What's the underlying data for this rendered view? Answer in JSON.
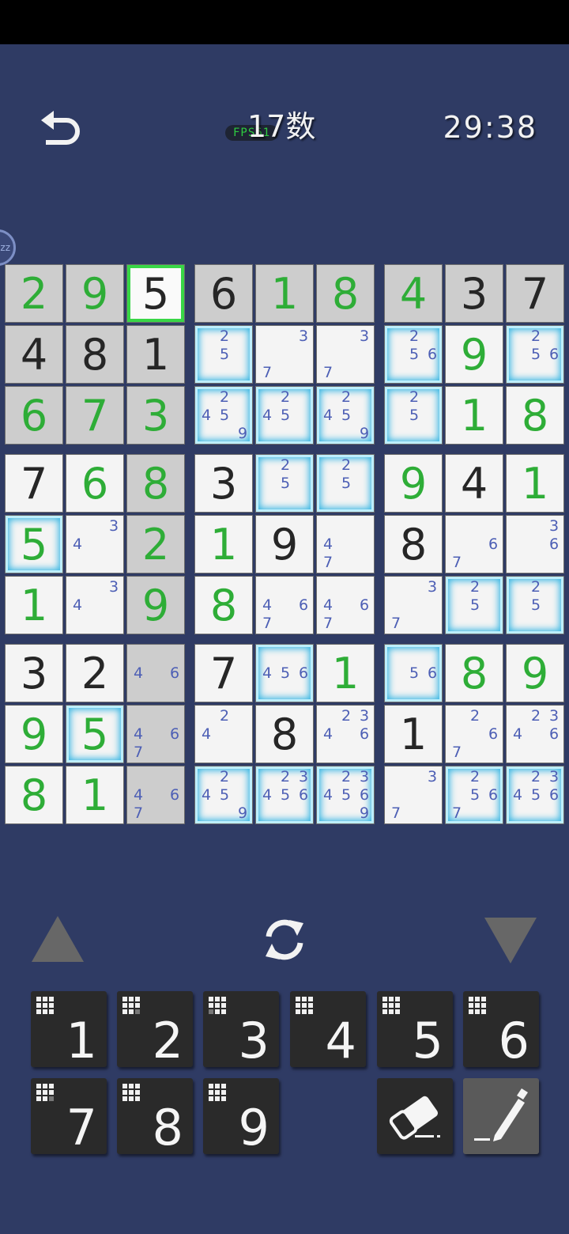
{
  "header": {
    "title": "17数",
    "fps": "FPS61",
    "timer": "29:38",
    "float_label": "zz"
  },
  "colors": {
    "background": "#2f3b64",
    "given_cell": "#cdcdcd",
    "empty_cell": "#f4f4f4",
    "user_digit": "#2ead37",
    "given_digit": "#262626",
    "note_digit": "#4d5fb5",
    "selection": "#38d646",
    "highlight_glow": "#37b6e3"
  },
  "board": {
    "cells": [
      [
        "g2",
        "g9",
        "k5",
        "k6",
        "g1",
        "g8",
        "g4",
        "k3",
        "k7"
      ],
      [
        "k4",
        "k8",
        "k1",
        "25",
        "37",
        "37",
        "256",
        "g9",
        "256"
      ],
      [
        "g6",
        "g7",
        "g3",
        "2459",
        "245",
        "2459",
        "25",
        "g1",
        "g8"
      ],
      [
        "k7",
        "g6",
        "g8",
        "k3",
        "25",
        "25",
        "g9",
        "k4",
        "g1"
      ],
      [
        "g5",
        "34",
        "g2",
        "g1",
        "k9",
        "47",
        "k8",
        "67",
        "36"
      ],
      [
        "g1",
        "34",
        "g9",
        "g8",
        "467",
        "467",
        "37",
        "25",
        "25"
      ],
      [
        "k3",
        "k2",
        "46",
        "k7",
        "456",
        "g1",
        "56",
        "g8",
        "g9"
      ],
      [
        "g9",
        "g5",
        "467",
        "24",
        "k8",
        "2346",
        "k1",
        "267",
        "2346"
      ],
      [
        "g8",
        "g1",
        "467",
        "2459",
        "23456",
        "234569",
        "37",
        "2567",
        "23456"
      ]
    ],
    "given_bg": [
      [
        1,
        1,
        0,
        1,
        1,
        1,
        1,
        1,
        1
      ],
      [
        1,
        1,
        1,
        0,
        0,
        0,
        0,
        0,
        0
      ],
      [
        1,
        1,
        1,
        0,
        0,
        0,
        0,
        0,
        0
      ],
      [
        0,
        0,
        1,
        0,
        0,
        0,
        0,
        0,
        0
      ],
      [
        0,
        0,
        1,
        0,
        0,
        0,
        0,
        0,
        0
      ],
      [
        0,
        0,
        1,
        0,
        0,
        0,
        0,
        0,
        0
      ],
      [
        0,
        0,
        1,
        0,
        0,
        0,
        0,
        0,
        0
      ],
      [
        0,
        0,
        1,
        0,
        0,
        0,
        0,
        0,
        0
      ],
      [
        0,
        0,
        1,
        0,
        0,
        0,
        0,
        0,
        0
      ]
    ],
    "highlighted": [
      [
        0,
        0,
        0,
        0,
        0,
        0,
        0,
        0,
        0
      ],
      [
        0,
        0,
        0,
        1,
        0,
        0,
        1,
        0,
        1
      ],
      [
        0,
        0,
        0,
        1,
        1,
        1,
        1,
        0,
        0
      ],
      [
        0,
        0,
        0,
        0,
        1,
        1,
        0,
        0,
        0
      ],
      [
        1,
        0,
        0,
        0,
        0,
        0,
        0,
        0,
        0
      ],
      [
        0,
        0,
        0,
        0,
        0,
        0,
        0,
        1,
        1
      ],
      [
        0,
        0,
        0,
        0,
        1,
        0,
        1,
        0,
        0
      ],
      [
        0,
        1,
        0,
        0,
        0,
        0,
        0,
        0,
        0
      ],
      [
        0,
        0,
        0,
        1,
        1,
        1,
        0,
        1,
        1
      ]
    ],
    "selected": [
      0,
      2
    ]
  },
  "tools": {
    "up_icon": "triangle-up-icon",
    "refresh_icon": "refresh-icon",
    "down_icon": "triangle-down-icon"
  },
  "keypad": {
    "digits": [
      "1",
      "2",
      "3",
      "4",
      "5",
      "6",
      "7",
      "8",
      "9"
    ],
    "remaining_patterns": [
      [
        1,
        1,
        1,
        1,
        1,
        1,
        1,
        1,
        1
      ],
      [
        1,
        1,
        1,
        1,
        1,
        1,
        1,
        1,
        0
      ],
      [
        1,
        1,
        1,
        1,
        1,
        1,
        0,
        1,
        1
      ],
      [
        1,
        1,
        1,
        1,
        1,
        1,
        1,
        1,
        1
      ],
      [
        1,
        1,
        1,
        1,
        1,
        1,
        1,
        1,
        1
      ],
      [
        1,
        1,
        1,
        1,
        1,
        1,
        1,
        1,
        1
      ],
      [
        1,
        1,
        1,
        1,
        1,
        1,
        1,
        1,
        0
      ],
      [
        1,
        1,
        1,
        1,
        1,
        1,
        1,
        1,
        1
      ],
      [
        1,
        1,
        1,
        1,
        1,
        1,
        1,
        1,
        1
      ]
    ],
    "eraser_icon": "eraser-icon",
    "pencil_icon": "pencil-icon"
  }
}
